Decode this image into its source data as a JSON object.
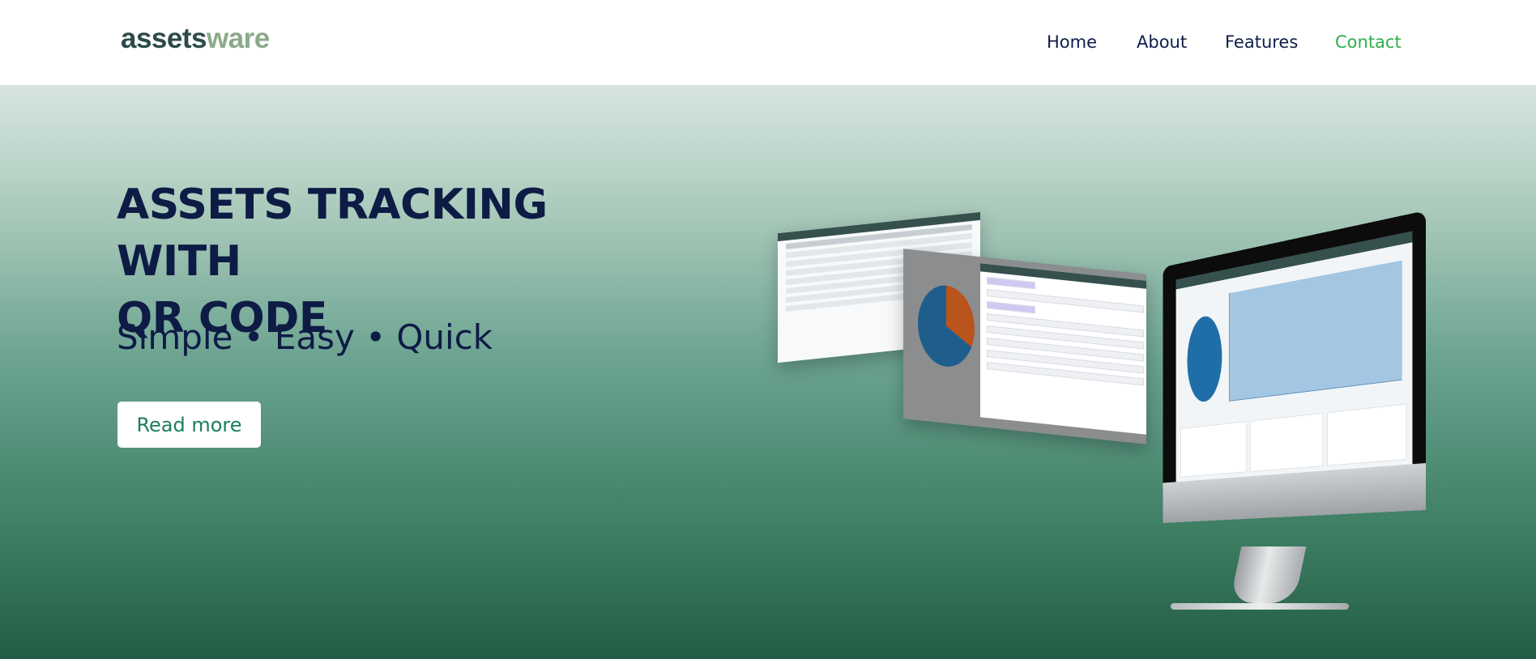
{
  "header": {
    "logo": {
      "part1": "assets",
      "part2": "ware"
    },
    "nav": [
      "Home",
      "About",
      "Features",
      "Contact"
    ]
  },
  "hero": {
    "title_line1": "ASSETS TRACKING WITH",
    "title_line2": "QR CODE",
    "subtitle": "Simple • Easy • Quick",
    "cta_label": "Read more"
  },
  "colors": {
    "title": "#0d1b45",
    "accent_green": "#2fae4a",
    "button_text": "#1d7f5b"
  }
}
